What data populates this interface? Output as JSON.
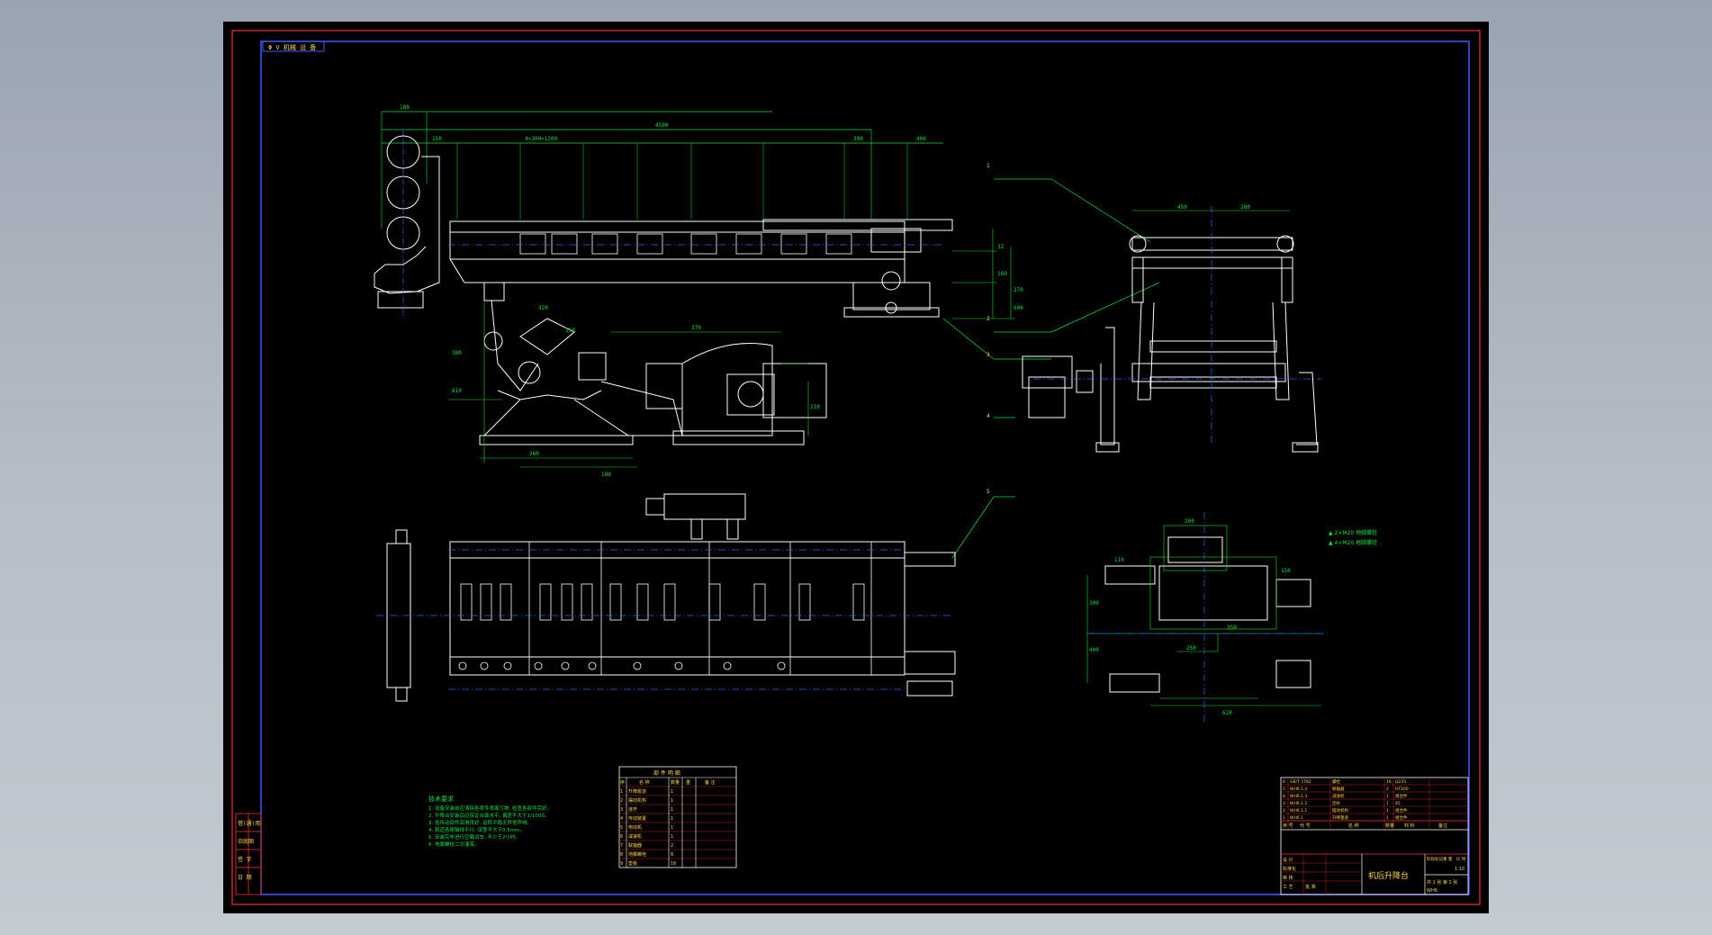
{
  "colors": {
    "background": "#000000",
    "frame_outer": "#c8242d",
    "frame_inner": "#3f5bff",
    "geometry": "#ffffff",
    "dimension": "#19e13a",
    "centerline": "#2a66ff",
    "text": "#ffd54a"
  },
  "drawing": {
    "title_ref": "Φ V 机械 设 备",
    "callouts": [
      "1",
      "2",
      "3",
      "4",
      "5"
    ],
    "top_dimensions": [
      "180",
      "4500",
      "150",
      "4×300=1200",
      "300",
      "400"
    ],
    "right_dimensions": [
      "32",
      "160",
      "270",
      "600"
    ],
    "left_dimensions": [
      "380",
      "810"
    ],
    "lower_dimensions": [
      "320",
      "150",
      "370",
      "210",
      "450",
      "450"
    ],
    "bottom_dimensions": [
      "260",
      "180"
    ],
    "side_view_dimensions": [
      "450",
      "280"
    ],
    "foundation_dimensions": [
      "200",
      "110",
      "150",
      "300",
      "400",
      "350",
      "620",
      "250"
    ],
    "foundation_notes": [
      "▲ 2×M20 地脚螺栓",
      "▲ 4×M20 地脚螺栓"
    ]
  },
  "tech_requirements": {
    "title": "技术要求",
    "lines": [
      "1. 设备安装前应清除各零件表面污物, 检查各部件完好。",
      "2. 升降台安装后应保证台面水平, 偏差不大于1/1000。",
      "3. 各传动部件润滑良好, 运转平稳无异常声响。",
      "4. 辊道各辊轴线平行, 误差不大于0.5mm。",
      "5. 安装完毕进行空载试车, 不少于2小时。",
      "6. 地脚螺栓二次灌浆。"
    ]
  },
  "parts_list": {
    "title": "部 件 明 细",
    "headers": [
      "序",
      "名 称",
      "数量",
      "重",
      "备 注"
    ],
    "rows": [
      [
        "1",
        "升降辊道",
        "1",
        "",
        ""
      ],
      [
        "2",
        "摆动机构",
        "1",
        "",
        ""
      ],
      [
        "3",
        "连杆",
        "1",
        "",
        ""
      ],
      [
        "4",
        "传动装置",
        "1",
        "",
        ""
      ],
      [
        "5",
        "电动机",
        "1",
        "",
        ""
      ],
      [
        "6",
        "减速机",
        "1",
        "",
        ""
      ],
      [
        "7",
        "联轴器",
        "2",
        "",
        ""
      ],
      [
        "8",
        "地脚螺栓",
        "8",
        "",
        ""
      ],
      [
        "9",
        "垫板",
        "16",
        "",
        ""
      ]
    ]
  },
  "left_stamp": [
    "借(通)用",
    "旧底图",
    "签 字",
    "日 期"
  ],
  "title_block": {
    "rows": [
      [
        "6",
        "GB/T 5782",
        "螺栓",
        "16",
        "Q235",
        ""
      ],
      [
        "5",
        "WH6.1.4",
        "联轴器",
        "2",
        "HT200",
        ""
      ],
      [
        "4",
        "WH6.1.3",
        "减速机",
        "1",
        "组合件",
        ""
      ],
      [
        "3",
        "WH6.1.2",
        "连杆",
        "1",
        "45",
        ""
      ],
      [
        "2",
        "WH6.1.1",
        "摆动机构",
        "1",
        "组合件",
        ""
      ],
      [
        "1",
        "WH6.1",
        "升降辊道",
        "1",
        "组合件",
        ""
      ]
    ],
    "header_row": [
      "序 号",
      "代 号",
      "名 称",
      "数量",
      "材 料",
      "备注"
    ],
    "design_labels": [
      "设 计",
      "标准化",
      "审 核",
      "工 艺",
      "批 准"
    ],
    "drawing_name": "机后升降台",
    "stage_labels": [
      "阶段标记",
      "重 量",
      "比 例"
    ],
    "scale": "1:10",
    "sheet": "共 1 张  第 1 张",
    "code": "WH6"
  }
}
